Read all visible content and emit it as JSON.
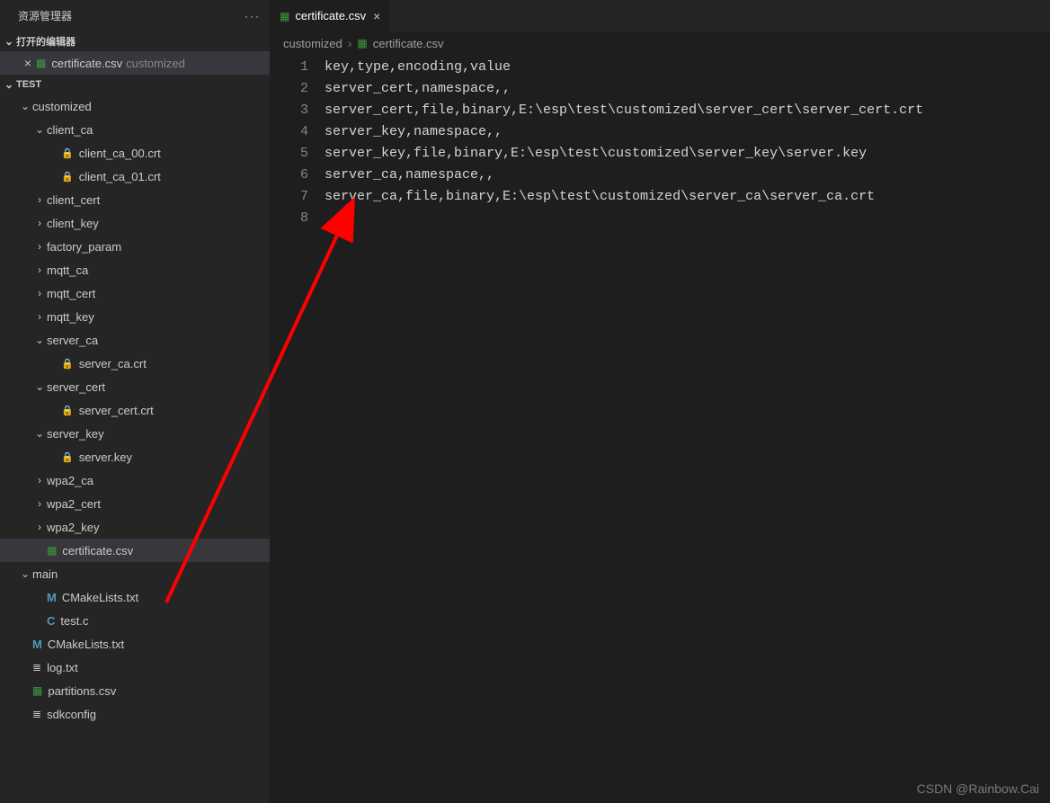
{
  "sidebar": {
    "title": "资源管理器",
    "open_editors_label": "打开的编辑器",
    "open_editor": {
      "name": "certificate.csv",
      "folder": "customized"
    },
    "project_label": "TEST",
    "tree": [
      {
        "type": "folder",
        "name": "customized",
        "indent": 1,
        "open": true
      },
      {
        "type": "folder",
        "name": "client_ca",
        "indent": 2,
        "open": true
      },
      {
        "type": "lockfile",
        "name": "client_ca_00.crt",
        "indent": 3
      },
      {
        "type": "lockfile",
        "name": "client_ca_01.crt",
        "indent": 3
      },
      {
        "type": "folder",
        "name": "client_cert",
        "indent": 2,
        "open": false
      },
      {
        "type": "folder",
        "name": "client_key",
        "indent": 2,
        "open": false
      },
      {
        "type": "folder",
        "name": "factory_param",
        "indent": 2,
        "open": false
      },
      {
        "type": "folder",
        "name": "mqtt_ca",
        "indent": 2,
        "open": false
      },
      {
        "type": "folder",
        "name": "mqtt_cert",
        "indent": 2,
        "open": false
      },
      {
        "type": "folder",
        "name": "mqtt_key",
        "indent": 2,
        "open": false
      },
      {
        "type": "folder",
        "name": "server_ca",
        "indent": 2,
        "open": true
      },
      {
        "type": "lockfile",
        "name": "server_ca.crt",
        "indent": 3
      },
      {
        "type": "folder",
        "name": "server_cert",
        "indent": 2,
        "open": true
      },
      {
        "type": "lockfile",
        "name": "server_cert.crt",
        "indent": 3
      },
      {
        "type": "folder",
        "name": "server_key",
        "indent": 2,
        "open": true
      },
      {
        "type": "lockfile",
        "name": "server.key",
        "indent": 3
      },
      {
        "type": "folder",
        "name": "wpa2_ca",
        "indent": 2,
        "open": false
      },
      {
        "type": "folder",
        "name": "wpa2_cert",
        "indent": 2,
        "open": false
      },
      {
        "type": "folder",
        "name": "wpa2_key",
        "indent": 2,
        "open": false
      },
      {
        "type": "tablefile",
        "name": "certificate.csv",
        "indent": 2,
        "selected": true
      },
      {
        "type": "folder",
        "name": "main",
        "indent": 1,
        "open": true
      },
      {
        "type": "mfile",
        "name": "CMakeLists.txt",
        "indent": 2
      },
      {
        "type": "cfile",
        "name": "test.c",
        "indent": 2
      },
      {
        "type": "mfile",
        "name": "CMakeLists.txt",
        "indent": 1
      },
      {
        "type": "linesfile",
        "name": "log.txt",
        "indent": 1
      },
      {
        "type": "tablefile",
        "name": "partitions.csv",
        "indent": 1
      },
      {
        "type": "linesfile",
        "name": "sdkconfig",
        "indent": 1
      }
    ]
  },
  "tab": {
    "label": "certificate.csv"
  },
  "breadcrumb": {
    "folder": "customized",
    "file": "certificate.csv"
  },
  "editor": {
    "lines": [
      "key,type,encoding,value",
      "server_cert,namespace,,",
      "server_cert,file,binary,E:\\esp\\test\\customized\\server_cert\\server_cert.crt",
      "server_key,namespace,,",
      "server_key,file,binary,E:\\esp\\test\\customized\\server_key\\server.key",
      "server_ca,namespace,,",
      "server_ca,file,binary,E:\\esp\\test\\customized\\server_ca\\server_ca.crt",
      ""
    ]
  },
  "watermark": "CSDN @Rainbow.Cai"
}
